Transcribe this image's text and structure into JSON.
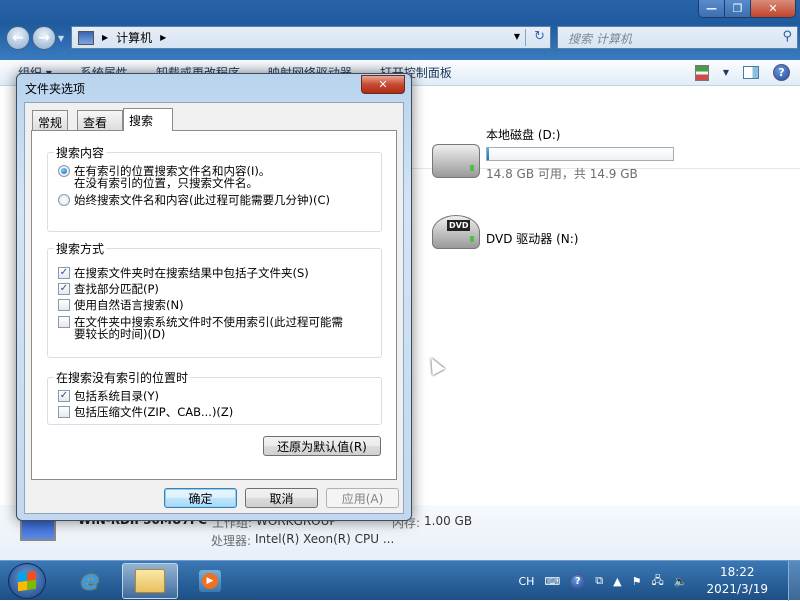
{
  "explorer": {
    "window_controls": {
      "minimize": "—",
      "restore": "❐",
      "close": "✕"
    },
    "address": {
      "path": [
        "计算机"
      ],
      "dropdown": "▼",
      "refresh": "↻"
    },
    "search": {
      "placeholder": "搜索 计算机"
    },
    "toolbar": {
      "items": [
        "组织 ▾",
        "系统属性",
        "卸载或更改程序",
        "映射网络驱动器",
        "打开控制面板"
      ]
    },
    "drives": [
      {
        "name": "本地磁盘 (D:)",
        "free_text": "14.8 GB 可用，共 14.9 GB",
        "used_fraction": 0.007
      },
      {
        "name": "DVD 驱动器 (N:)",
        "badge": "DVD"
      }
    ],
    "details": {
      "computer_name": "WIN-RDIP50MU7FC",
      "workgroup_label": "工作组:",
      "workgroup": "WORKGROUP",
      "memory_label": "内存:",
      "memory": "1.00 GB",
      "cpu_label": "处理器:",
      "cpu": "Intel(R) Xeon(R) CPU ..."
    }
  },
  "dialog": {
    "title": "文件夹选项",
    "close": "✕",
    "tabs": [
      {
        "label": "常规"
      },
      {
        "label": "查看"
      },
      {
        "label": "搜索",
        "selected": true
      }
    ],
    "search_content": {
      "label": "搜索内容",
      "options": [
        {
          "label": "在有索引的位置搜索文件名和内容(I)。",
          "sub": "在没有索引的位置，只搜索文件名。",
          "selected": true
        },
        {
          "label": "始终搜索文件名和内容(此过程可能需要几分钟)(C)",
          "selected": false
        }
      ]
    },
    "search_method": {
      "label": "搜索方式",
      "options": [
        {
          "label": "在搜索文件夹时在搜索结果中包括子文件夹(S)",
          "checked": true
        },
        {
          "label": "查找部分匹配(P)",
          "checked": true
        },
        {
          "label": "使用自然语言搜索(N)",
          "checked": false
        },
        {
          "label": "在文件夹中搜索系统文件时不使用索引(此过程可能需",
          "sub": "要较长的时间)(D)",
          "checked": false
        }
      ]
    },
    "non_indexed": {
      "label": "在搜索没有索引的位置时",
      "options": [
        {
          "label": "包括系统目录(Y)",
          "checked": true
        },
        {
          "label": "包括压缩文件(ZIP、CAB...)(Z)",
          "checked": false
        }
      ]
    },
    "restore_defaults": "还原为默认值(R)",
    "ok": "确定",
    "cancel": "取消",
    "apply": "应用(A)"
  },
  "taskbar": {
    "lang": "CH",
    "time": "18:22",
    "date": "2021/3/19",
    "check": "✓"
  }
}
